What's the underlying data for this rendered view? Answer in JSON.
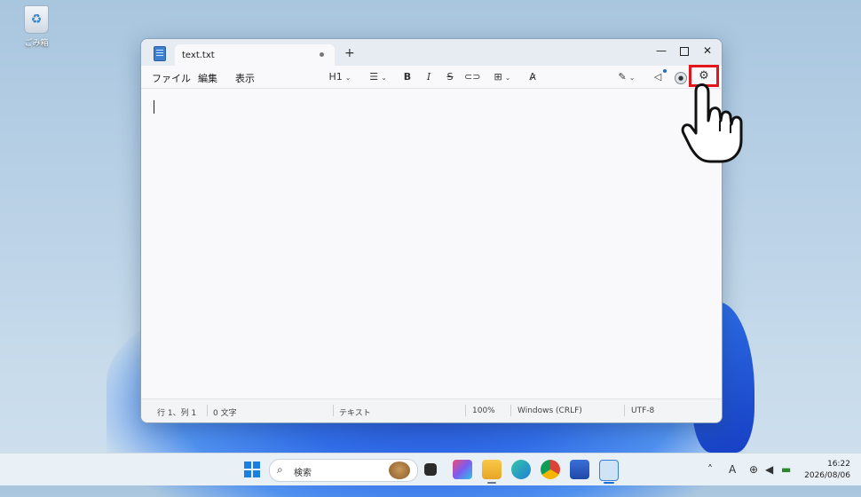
{
  "desktop": {
    "recycle_bin_label": "ごみ箱"
  },
  "window": {
    "tab_title": "text.txt",
    "new_tab_glyph": "+",
    "controls": {
      "minimize": "—",
      "close": "✕"
    }
  },
  "menu": {
    "file": "ファイル",
    "edit": "編集",
    "view": "表示"
  },
  "toolbar": {
    "heading": "H1",
    "bold": "B",
    "italic": "I",
    "strike": "S"
  },
  "status": {
    "position": "行 1、列 1",
    "chars": "0 文字",
    "format": "テキスト",
    "zoom": "100%",
    "line_ending": "Windows (CRLF)",
    "encoding": "UTF-8"
  },
  "taskbar": {
    "search_placeholder": "検索",
    "time": "16:22",
    "date": "2026/08/06",
    "ime": "A"
  },
  "colors": {
    "highlight": "#e2161b",
    "accent": "#1e6fd0"
  }
}
